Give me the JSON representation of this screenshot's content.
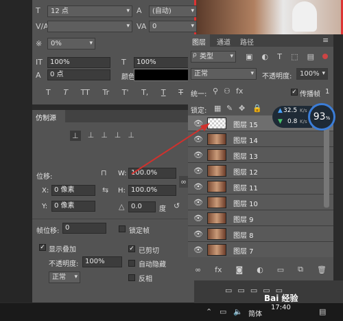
{
  "character": {
    "font_size": "12 点",
    "leading": "(自动)",
    "kerning": "",
    "tracking": "0",
    "baseline_pct": "0%",
    "vscale": "100%",
    "hscale": "100%",
    "shift": "0 点",
    "color_label": "颜色:",
    "styles": [
      "T",
      "T",
      "TT",
      "Tr",
      "T'",
      "T,",
      "T",
      "T"
    ]
  },
  "clone_source": {
    "tab": "仿制源",
    "offset_label": "位移:",
    "x_label": "X:",
    "x_value": "0 像素",
    "y_label": "Y:",
    "y_value": "0 像素",
    "w_label": "W:",
    "w_value": "100.0%",
    "h_label": "H:",
    "h_value": "100.0%",
    "angle_value": "0.0",
    "angle_unit": "度",
    "frame_offset_label": "帧位移:",
    "frame_offset_value": "0",
    "lock_frame": "锁定帧",
    "show_overlay": "显示叠加",
    "opacity_label": "不透明度:",
    "opacity_value": "100%",
    "clipped": "已剪切",
    "auto_hide": "自动隐藏",
    "invert": "反相",
    "blend": "正常"
  },
  "layers": {
    "tabs": [
      "图层",
      "通道",
      "路径"
    ],
    "filter_kind": "类型",
    "blend_mode": "正常",
    "opacity_label": "不透明度:",
    "opacity_value": "100%",
    "unify_label": "统一:",
    "propagate_label": "传播帧",
    "propagate_value": "1",
    "lock_label": "锁定:",
    "items": [
      "图层 15",
      "图层 14",
      "图层 13",
      "图层 12",
      "图层 11",
      "图层 10",
      "图层 9",
      "图层 8",
      "图层 7"
    ],
    "footer_icons": [
      "link-icon",
      "fx-icon",
      "mask-icon",
      "adjustment-icon",
      "group-icon",
      "new-layer-icon",
      "trash-icon"
    ]
  },
  "net_widget": {
    "upload": "32.5",
    "upload_unit": "K/s",
    "download": "0.8",
    "download_unit": "K/s",
    "percent": "93",
    "percent_sign": "%"
  },
  "taskbar": {
    "time": "17:40",
    "ime": "简体",
    "watermark": "Bai 经验"
  },
  "colors": {
    "accent": "#3b7dd8",
    "arrow": "#d0312d",
    "panel": "#535353"
  }
}
